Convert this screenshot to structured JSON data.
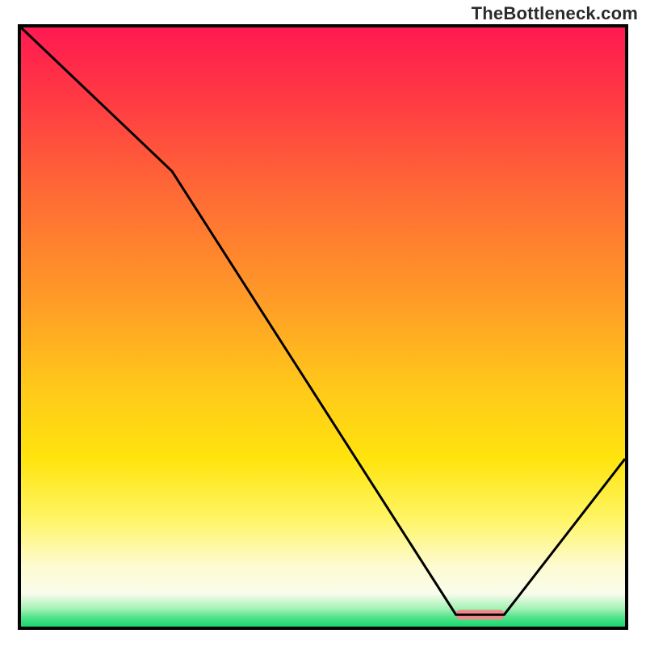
{
  "watermark": "TheBottleneck.com",
  "colors": {
    "frame": "#000000",
    "curve": "#000000",
    "marker": "#f08888",
    "gradient_stops": [
      {
        "offset": 0.0,
        "color": "#ff1951"
      },
      {
        "offset": 0.12,
        "color": "#ff3a43"
      },
      {
        "offset": 0.28,
        "color": "#ff6b35"
      },
      {
        "offset": 0.45,
        "color": "#ff9a27"
      },
      {
        "offset": 0.6,
        "color": "#ffc81a"
      },
      {
        "offset": 0.72,
        "color": "#ffe40d"
      },
      {
        "offset": 0.82,
        "color": "#fff565"
      },
      {
        "offset": 0.9,
        "color": "#fdfbd2"
      },
      {
        "offset": 0.945,
        "color": "#f9fceb"
      },
      {
        "offset": 0.97,
        "color": "#a4f2b6"
      },
      {
        "offset": 0.985,
        "color": "#4fe28a"
      },
      {
        "offset": 1.0,
        "color": "#18d86c"
      }
    ]
  },
  "chart_data": {
    "type": "line",
    "title": "",
    "xlabel": "",
    "ylabel": "",
    "xlim": [
      0,
      100
    ],
    "ylim": [
      0,
      100
    ],
    "legend": false,
    "x": [
      0,
      25,
      72,
      80,
      100
    ],
    "values": [
      100,
      76,
      2,
      2,
      28
    ],
    "marker_x_range": [
      72,
      80
    ],
    "marker_y": 2,
    "notes": "Heat-gradient background encodes y-value (red high, green low). Black curve drops from top-left, has a kink around x≈25, reaches minimum on a flat segment around x≈72–80 (pink marker), then rises toward x=100."
  }
}
